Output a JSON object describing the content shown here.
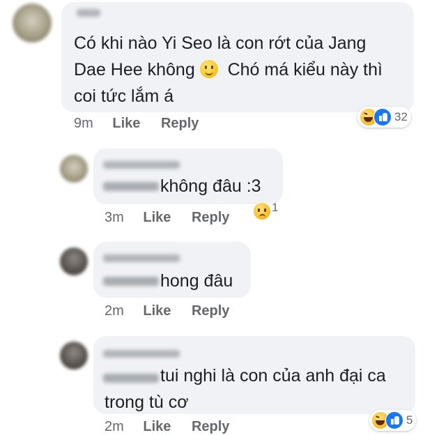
{
  "comments": [
    {
      "text_lines": [
        "Có khi nào Yi Seo là con rớt của Jang",
        "Dae Hee không",
        "Chó má kiểu này thì",
        "coi tức lắm á"
      ],
      "emoji": "slightly-smiling-face-icon",
      "time": "9m",
      "like": "Like",
      "reply": "Reply",
      "reaction_count": "32",
      "reactions": [
        "haha-reaction-icon",
        "like-reaction-icon"
      ]
    },
    {
      "text": "không đâu :3",
      "time": "3m",
      "like": "Like",
      "reply": "Reply",
      "reaction_count": "1",
      "reactions": [
        "sad-reaction-icon"
      ]
    },
    {
      "text": "hong đâu",
      "time": "2m",
      "like": "Like",
      "reply": "Reply"
    },
    {
      "text_lines": [
        "tui nghi là con của anh đại ca",
        "trong tù cơ"
      ],
      "time": "2m",
      "like": "Like",
      "reply": "Reply",
      "reaction_count": "5",
      "reactions": [
        "haha-reaction-icon",
        "like-reaction-icon"
      ]
    }
  ],
  "colors": {
    "bubble": "#f0f2f5",
    "meta": "#65676b",
    "like_blue": "#1877f2",
    "text": "#1c1e21"
  }
}
